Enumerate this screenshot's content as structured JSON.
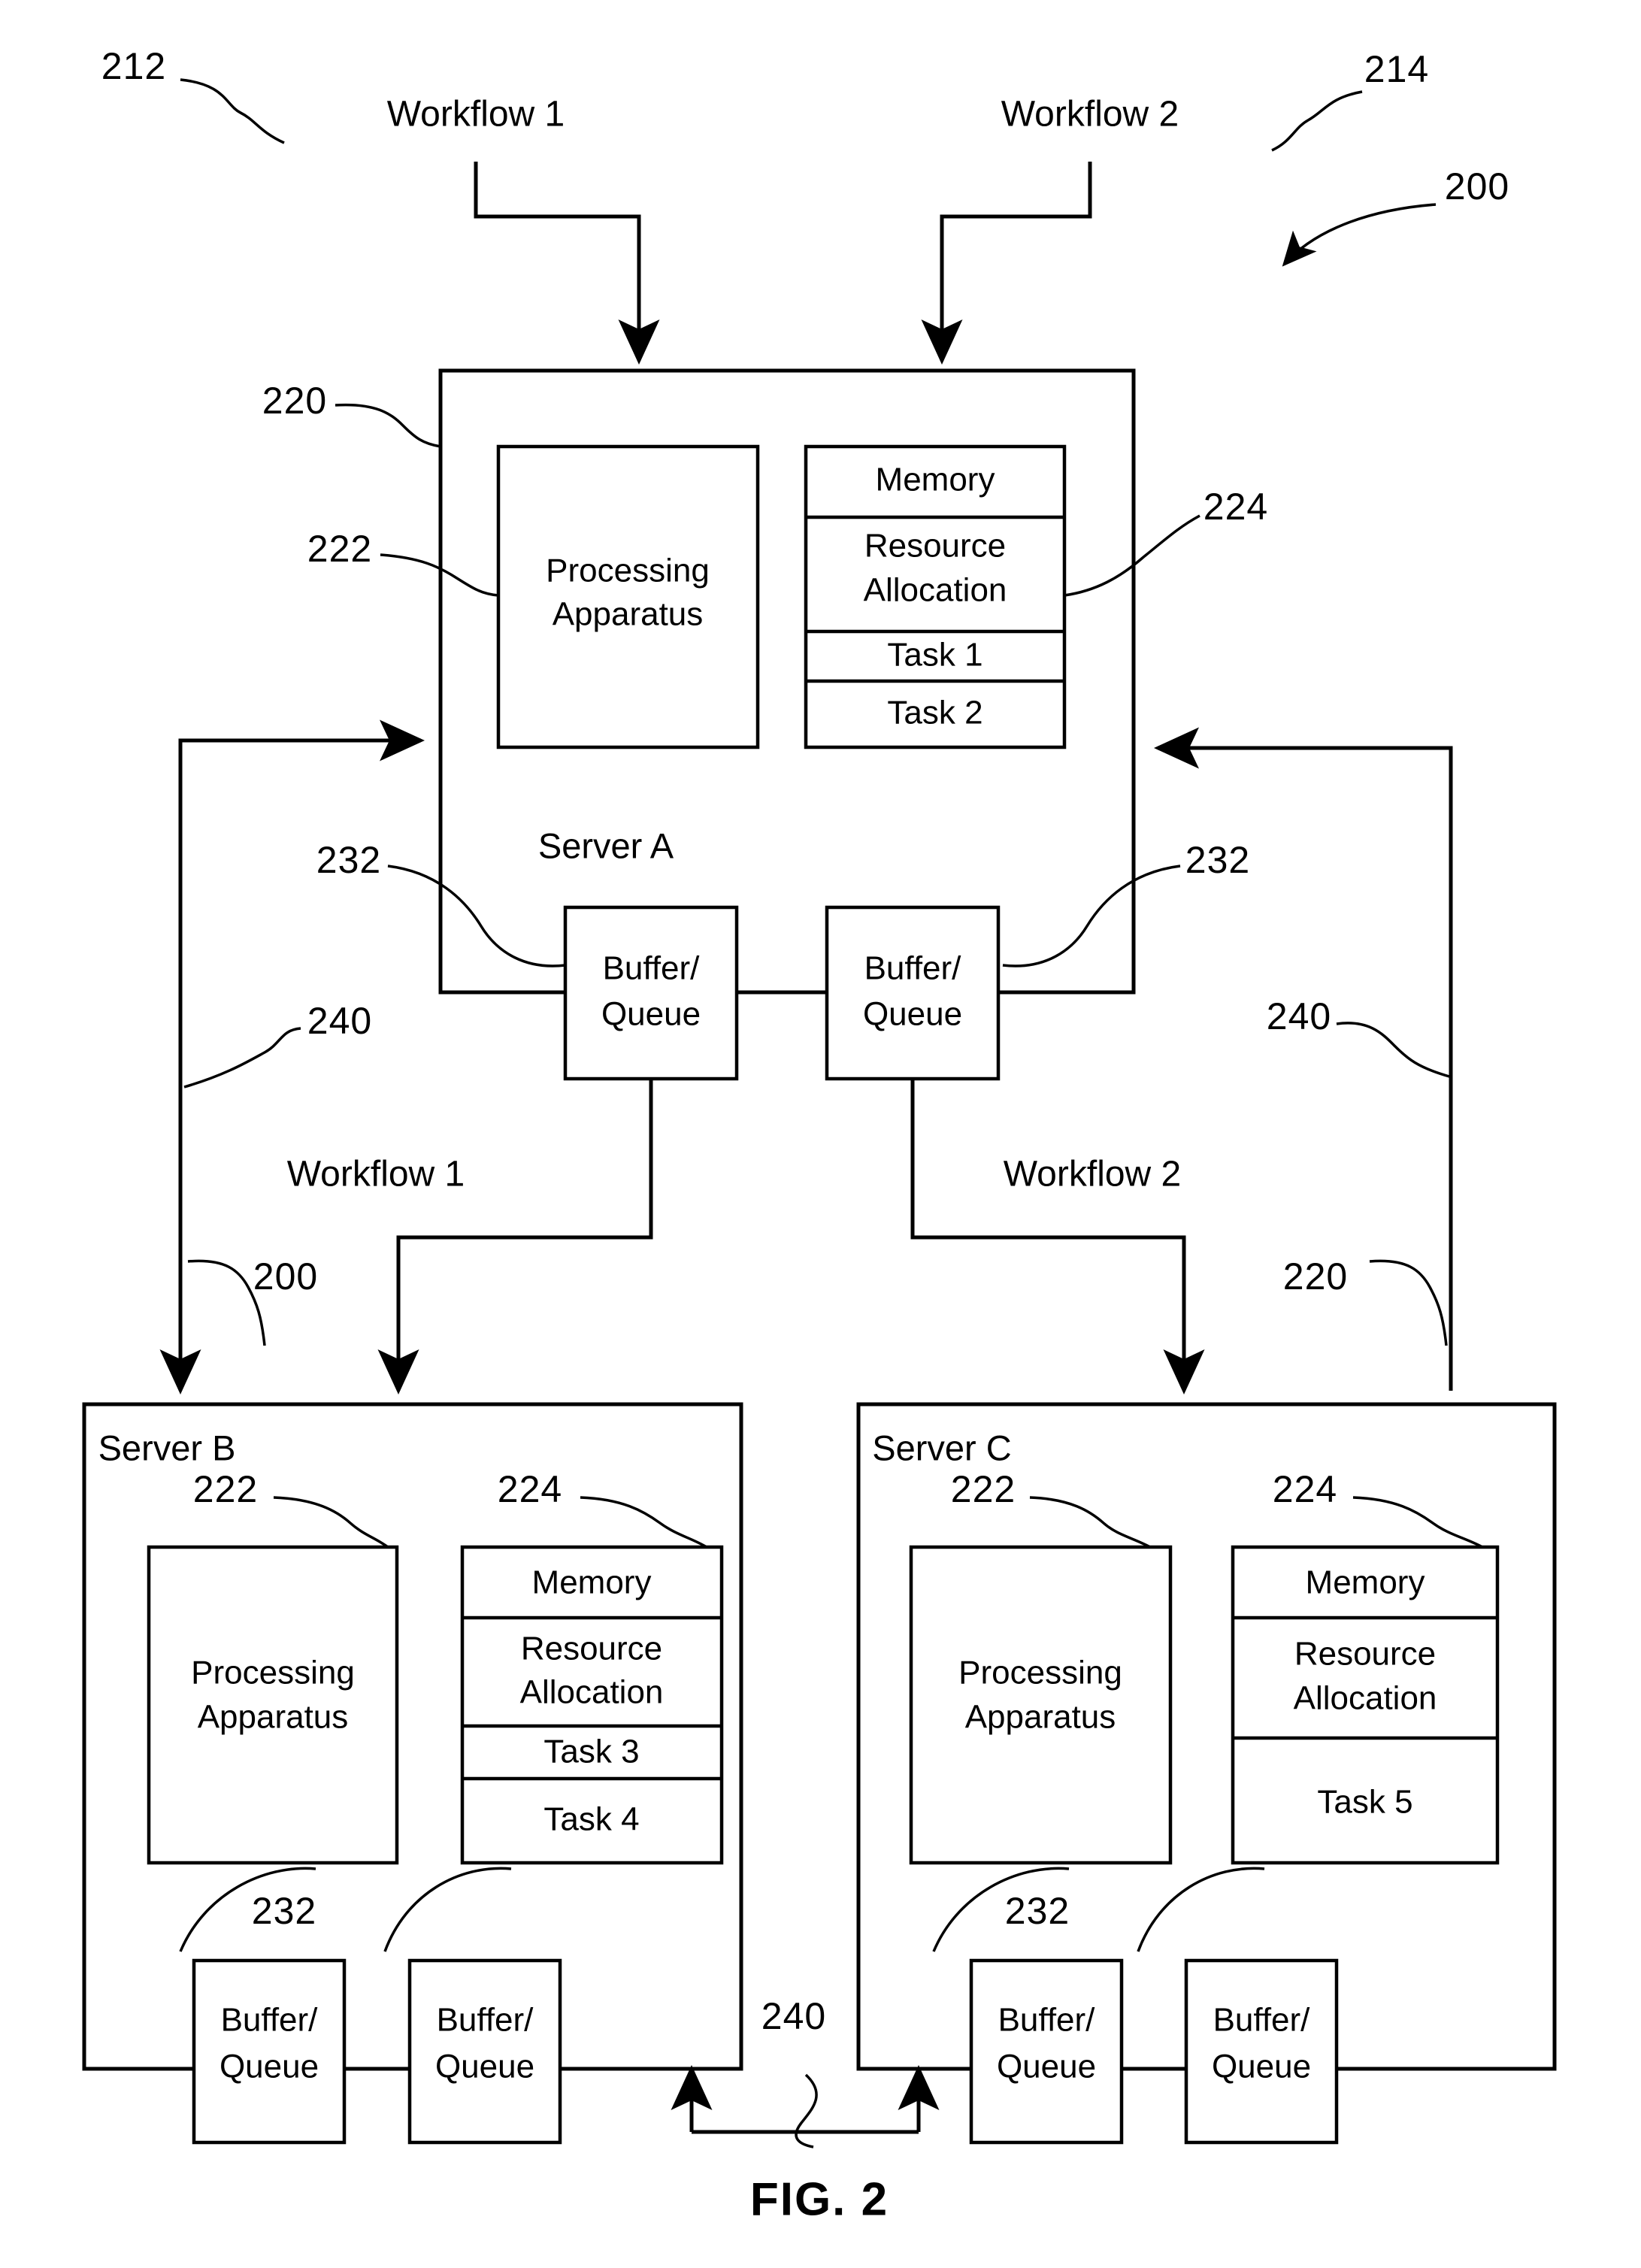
{
  "figure": {
    "caption": "FIG. 2",
    "system_ref": "200"
  },
  "workflows": {
    "top": [
      {
        "label": "Workflow 1",
        "ref": "212"
      },
      {
        "label": "Workflow 2",
        "ref": "214"
      }
    ],
    "middle": [
      {
        "label": "Workflow 1"
      },
      {
        "label": "Workflow 2"
      }
    ]
  },
  "refs": {
    "system": "200",
    "server": "220",
    "processing_apparatus": "222",
    "memory": "224",
    "buffer_queue": "232",
    "link": "240"
  },
  "servers": [
    {
      "name": "Server A",
      "ref": "220",
      "processing": {
        "line1": "Processing",
        "line2": "Apparatus",
        "ref": "222"
      },
      "memory": {
        "ref": "224",
        "title": "Memory",
        "rows": [
          "Resource Allocation",
          "Task 1",
          "Task 2"
        ],
        "resource_line1": "Resource",
        "resource_line2": "Allocation",
        "task_a": "Task 1",
        "task_b": "Task 2"
      },
      "buffers": [
        {
          "line1": "Buffer/",
          "line2": "Queue",
          "ref": "232"
        },
        {
          "line1": "Buffer/",
          "line2": "Queue",
          "ref": "232"
        }
      ]
    },
    {
      "name": "Server B",
      "ref": "200",
      "processing": {
        "line1": "Processing",
        "line2": "Apparatus",
        "ref": "222"
      },
      "memory": {
        "ref": "224",
        "title": "Memory",
        "rows": [
          "Resource Allocation",
          "Task 3",
          "Task 4"
        ],
        "resource_line1": "Resource",
        "resource_line2": "Allocation",
        "task_a": "Task 3",
        "task_b": "Task 4"
      },
      "buffers": [
        {
          "line1": "Buffer/",
          "line2": "Queue",
          "ref": "232"
        },
        {
          "line1": "Buffer/",
          "line2": "Queue",
          "ref": "232"
        }
      ]
    },
    {
      "name": "Server C",
      "ref": "220",
      "processing": {
        "line1": "Processing",
        "line2": "Apparatus",
        "ref": "222"
      },
      "memory": {
        "ref": "224",
        "title": "Memory",
        "rows": [
          "Resource Allocation",
          "Task 5"
        ],
        "resource_line1": "Resource",
        "resource_line2": "Allocation",
        "task_a": "Task 5"
      },
      "buffers": [
        {
          "line1": "Buffer/",
          "line2": "Queue",
          "ref": "232"
        },
        {
          "line1": "Buffer/",
          "line2": "Queue",
          "ref": "232"
        }
      ]
    }
  ],
  "link_refs": {
    "left_upper": "240",
    "right_upper": "240",
    "bottom": "240"
  },
  "colors": {
    "stroke": "#000000",
    "background": "#ffffff"
  }
}
